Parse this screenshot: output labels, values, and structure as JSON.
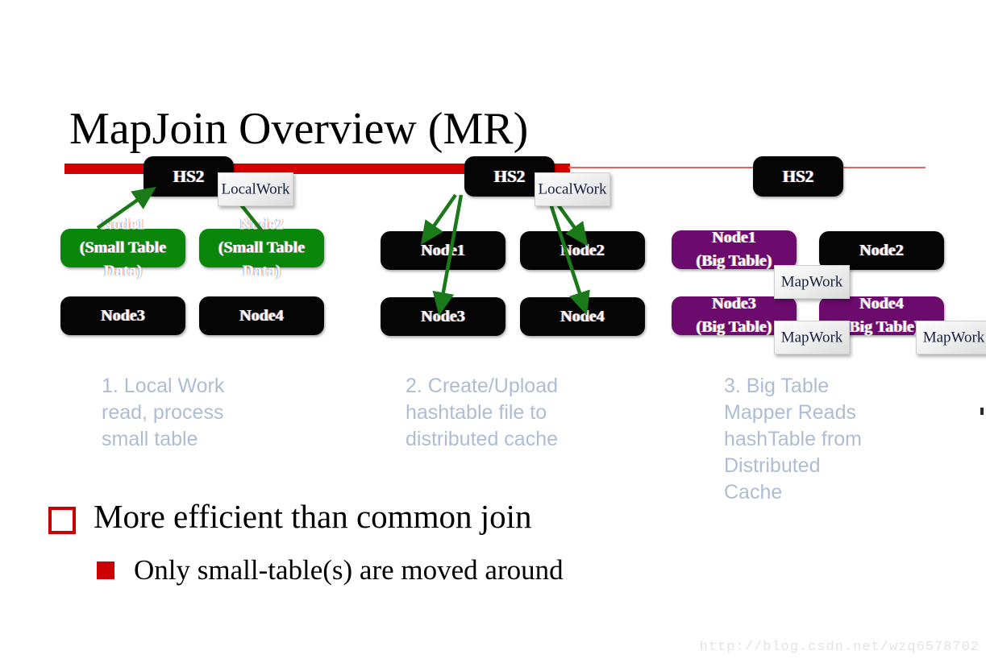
{
  "slide": {
    "title": "MapJoin Overview (MR)",
    "watermark": "http://blog.csdn.net/wzq6578702"
  },
  "colors": {
    "red_bar": "#d40000",
    "red_line_thin": "#e2675f",
    "node_black": "#050505",
    "node_green": "#0a870a",
    "node_purple": "#6d0a6d",
    "arrow_green": "#1a7a1a",
    "caption_blue": "#aebdd4",
    "bullet_red": "#cc0000",
    "watermark_gray": "#e3e3e1"
  },
  "stage1": {
    "hs2": "HS2",
    "callout": "LocalWork",
    "nodes": [
      {
        "label": "Node1\n(Small Table\nData)",
        "color": "green"
      },
      {
        "label": "Node2\n(Small Table\nData)",
        "color": "green"
      },
      {
        "label": "Node3",
        "color": "black"
      },
      {
        "label": "Node4",
        "color": "black"
      }
    ],
    "caption": "1. Local Work\nread, process\nsmall table"
  },
  "stage2": {
    "hs2": "HS2",
    "callout": "LocalWork",
    "nodes": [
      {
        "label": "Node1",
        "color": "black"
      },
      {
        "label": "Node2",
        "color": "black"
      },
      {
        "label": "Node3",
        "color": "black"
      },
      {
        "label": "Node4",
        "color": "black"
      }
    ],
    "caption": "2. Create/Upload\nhashtable file to\ndistributed cache"
  },
  "stage3": {
    "hs2": "HS2",
    "nodes": [
      {
        "label": "Node1\n(Big Table)",
        "color": "purple"
      },
      {
        "label": "Node2",
        "color": "black"
      },
      {
        "label": "Node3\n(Big Table)",
        "color": "purple"
      },
      {
        "label": "Node4\n(Big Table)",
        "color": "purple"
      }
    ],
    "callouts": [
      {
        "label": "MapWork"
      },
      {
        "label": "MapWork"
      },
      {
        "label": "MapWork"
      }
    ],
    "caption": "3. Big Table\nMapper Reads\nhashTable from\nDistributed\nCache"
  },
  "bullets": {
    "primary": "More efficient than common join",
    "secondary": "Only small-table(s) are moved around"
  }
}
